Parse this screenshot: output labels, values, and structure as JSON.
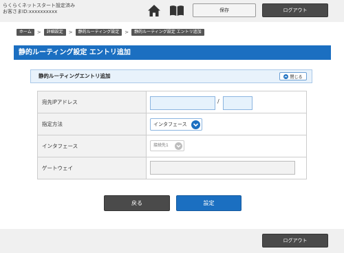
{
  "header": {
    "site_title": "らくらくネットスタート設定済み",
    "customer_label": "お客さまID:xxxxxxxxxx",
    "save_label": "保存",
    "logout_label": "ログアウト"
  },
  "breadcrumb": [
    {
      "label": "ホーム"
    },
    {
      "label": "詳細設定"
    },
    {
      "label": "静的ルーティング設定"
    },
    {
      "label": "静的ルーティング設定 エントリ追加"
    }
  ],
  "page": {
    "title": "静的ルーティング設定 エントリ追加"
  },
  "section": {
    "title": "静的ルーティングエントリ追加",
    "close_label": "閉じる"
  },
  "form": {
    "dest_ip_label": "宛先IPアドレス",
    "dest_ip_value": "",
    "slash": "/",
    "mask_value": "",
    "method_label": "指定方法",
    "method_selected": "インタフェース",
    "interface_label": "インタフェース",
    "interface_selected": "接続先1",
    "gateway_label": "ゲートウェイ",
    "gateway_value": ""
  },
  "actions": {
    "back_label": "戻る",
    "submit_label": "設定"
  },
  "footer": {
    "logout_label": "ログアウト"
  },
  "colors": {
    "brand_blue": "#1b6fc1",
    "dark_button": "#4a4a4a",
    "input_bg": "#e6f2fc"
  }
}
